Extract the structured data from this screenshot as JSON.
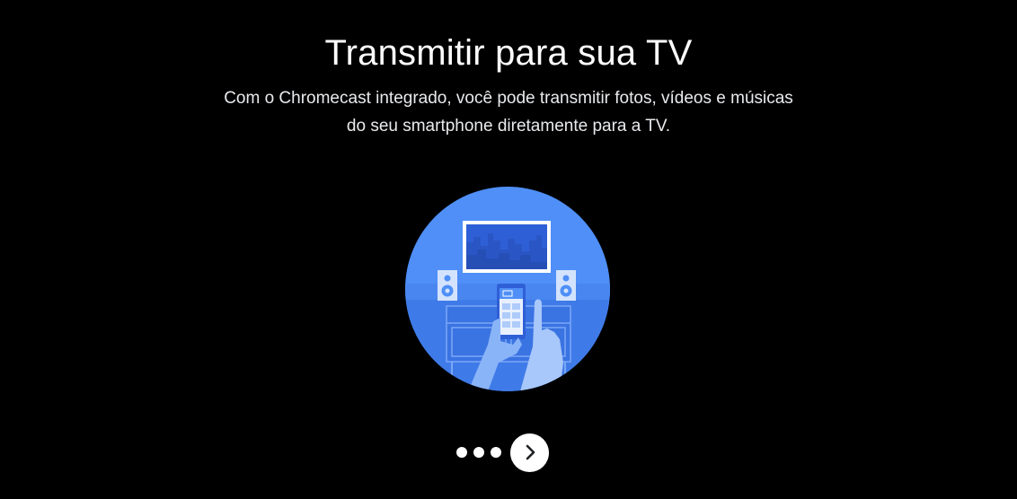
{
  "header": {
    "title": "Transmitir para sua TV",
    "description_lines": [
      "Com o Chromecast integrado, você pode transmitir fotos, vídeos e músicas",
      "do seu smartphone diretamente para a TV."
    ]
  },
  "illustration": {
    "icon": "cast-to-tv-illustration",
    "colors": {
      "circle": "#4f8ff7",
      "dark_blue": "#2f5fd6",
      "light_blue": "#8ab4f8",
      "screen_frame": "#ffffff"
    }
  },
  "pager": {
    "total_dots": 3,
    "next_icon": "chevron-right-icon"
  },
  "colors": {
    "background": "#000000",
    "text": "#ffffff",
    "button": "#ffffff",
    "button_icon": "#202124"
  }
}
